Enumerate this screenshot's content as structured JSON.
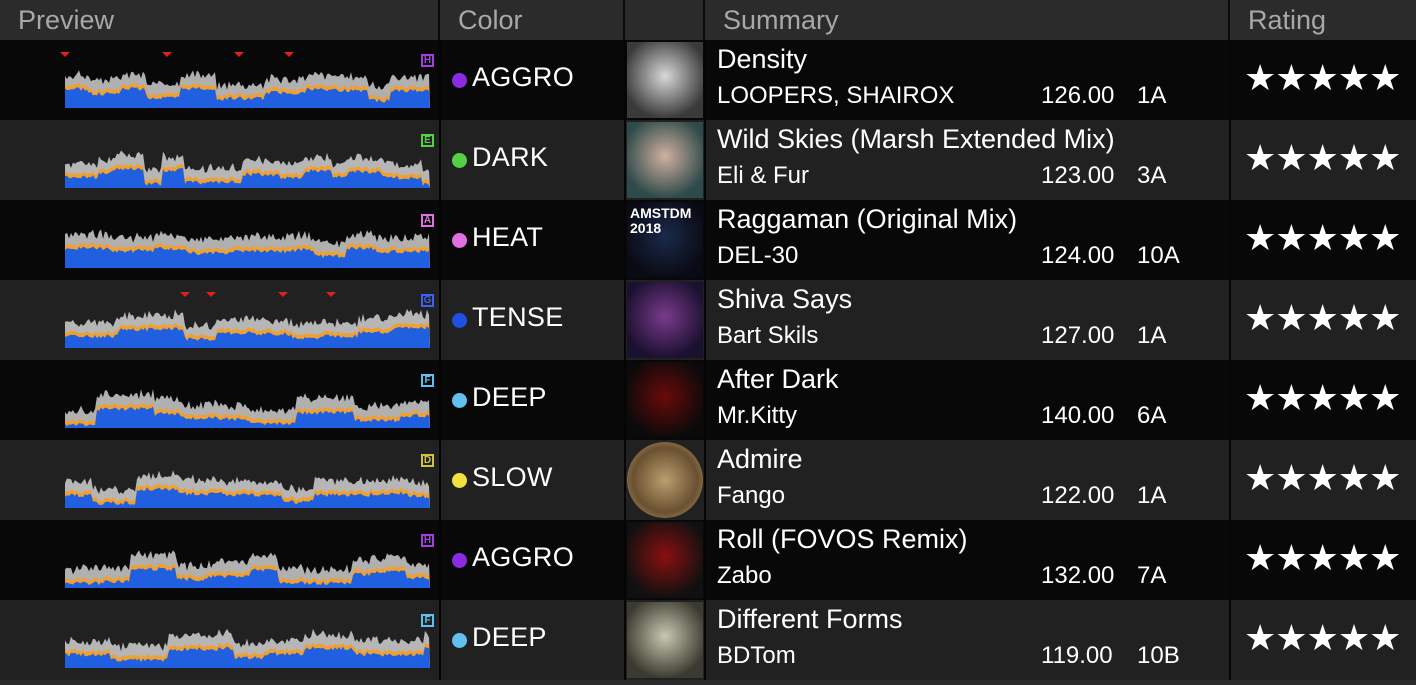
{
  "columns": {
    "preview": "Preview",
    "color": "Color",
    "art": "",
    "summary": "Summary",
    "rating": "Rating"
  },
  "star_glyphs": "★★★★★",
  "tracks": [
    {
      "title": "Density",
      "artist": "LOOPERS, SHAIROX",
      "bpm": "126.00",
      "key": "1A",
      "color_label": "AGGRO",
      "color_hex": "#8a2be2",
      "energy_letter": "H",
      "letter_color": "#a040e0",
      "rating": 5,
      "art_icon": "chrome-figure-art",
      "art_bg": [
        "#d8d8d8",
        "#3a3a3a"
      ]
    },
    {
      "title": "Wild Skies (Marsh Extended Mix)",
      "artist": "Eli & Fur",
      "bpm": "123.00",
      "key": "3A",
      "color_label": "DARK",
      "color_hex": "#55d045",
      "energy_letter": "E",
      "letter_color": "#55d045",
      "rating": 5,
      "art_icon": "two-women-art",
      "art_bg": [
        "#d0b0a0",
        "#2e4a4a"
      ]
    },
    {
      "title": "Raggaman (Original Mix)",
      "artist": "DEL-30",
      "bpm": "124.00",
      "key": "10A",
      "color_label": "HEAT",
      "color_hex": "#e070e0",
      "energy_letter": "A",
      "letter_color": "#e070e0",
      "rating": 5,
      "art_icon": "amstdm-2018-art",
      "art_bg": [
        "#1a2a4a",
        "#0a0a14"
      ],
      "art_text": "AMSTDM 2018"
    },
    {
      "title": "Shiva Says",
      "artist": "Bart Skils",
      "bpm": "127.00",
      "key": "1A",
      "color_label": "TENSE",
      "color_hex": "#2050e0",
      "energy_letter": "G",
      "letter_color": "#4060f0",
      "rating": 5,
      "art_icon": "cosmic-collage-art",
      "art_bg": [
        "#7a3a8a",
        "#1a1030"
      ]
    },
    {
      "title": "After Dark",
      "artist": "Mr.Kitty",
      "bpm": "140.00",
      "key": "6A",
      "color_label": "DEEP",
      "color_hex": "#60c0f0",
      "energy_letter": "F",
      "letter_color": "#60c0f0",
      "rating": 5,
      "art_icon": "hooded-figure-art",
      "art_bg": [
        "#6a0a0a",
        "#0a0a0a"
      ]
    },
    {
      "title": "Admire",
      "artist": "Fango",
      "bpm": "122.00",
      "key": "1A",
      "color_label": "SLOW",
      "color_hex": "#f0e040",
      "energy_letter": "D",
      "letter_color": "#d0c040",
      "rating": 5,
      "art_icon": "textured-circle-art",
      "art_bg": [
        "#b8a070",
        "#ffffff"
      ]
    },
    {
      "title": "Roll (FOVOS Remix)",
      "artist": "Zabo",
      "bpm": "132.00",
      "key": "7A",
      "color_label": "AGGRO",
      "color_hex": "#8a2be2",
      "energy_letter": "H",
      "letter_color": "#a040e0",
      "rating": 5,
      "art_icon": "red-corridor-art",
      "art_bg": [
        "#8a1010",
        "#101010"
      ]
    },
    {
      "title": "Different Forms",
      "artist": "BDTom",
      "bpm": "119.00",
      "key": "10B",
      "color_label": "DEEP",
      "color_hex": "#60c0f0",
      "energy_letter": "F",
      "letter_color": "#60c0f0",
      "rating": 5,
      "art_icon": "geometric-blocks-art",
      "art_bg": [
        "#c8c8b0",
        "#3a3a30"
      ]
    }
  ]
}
